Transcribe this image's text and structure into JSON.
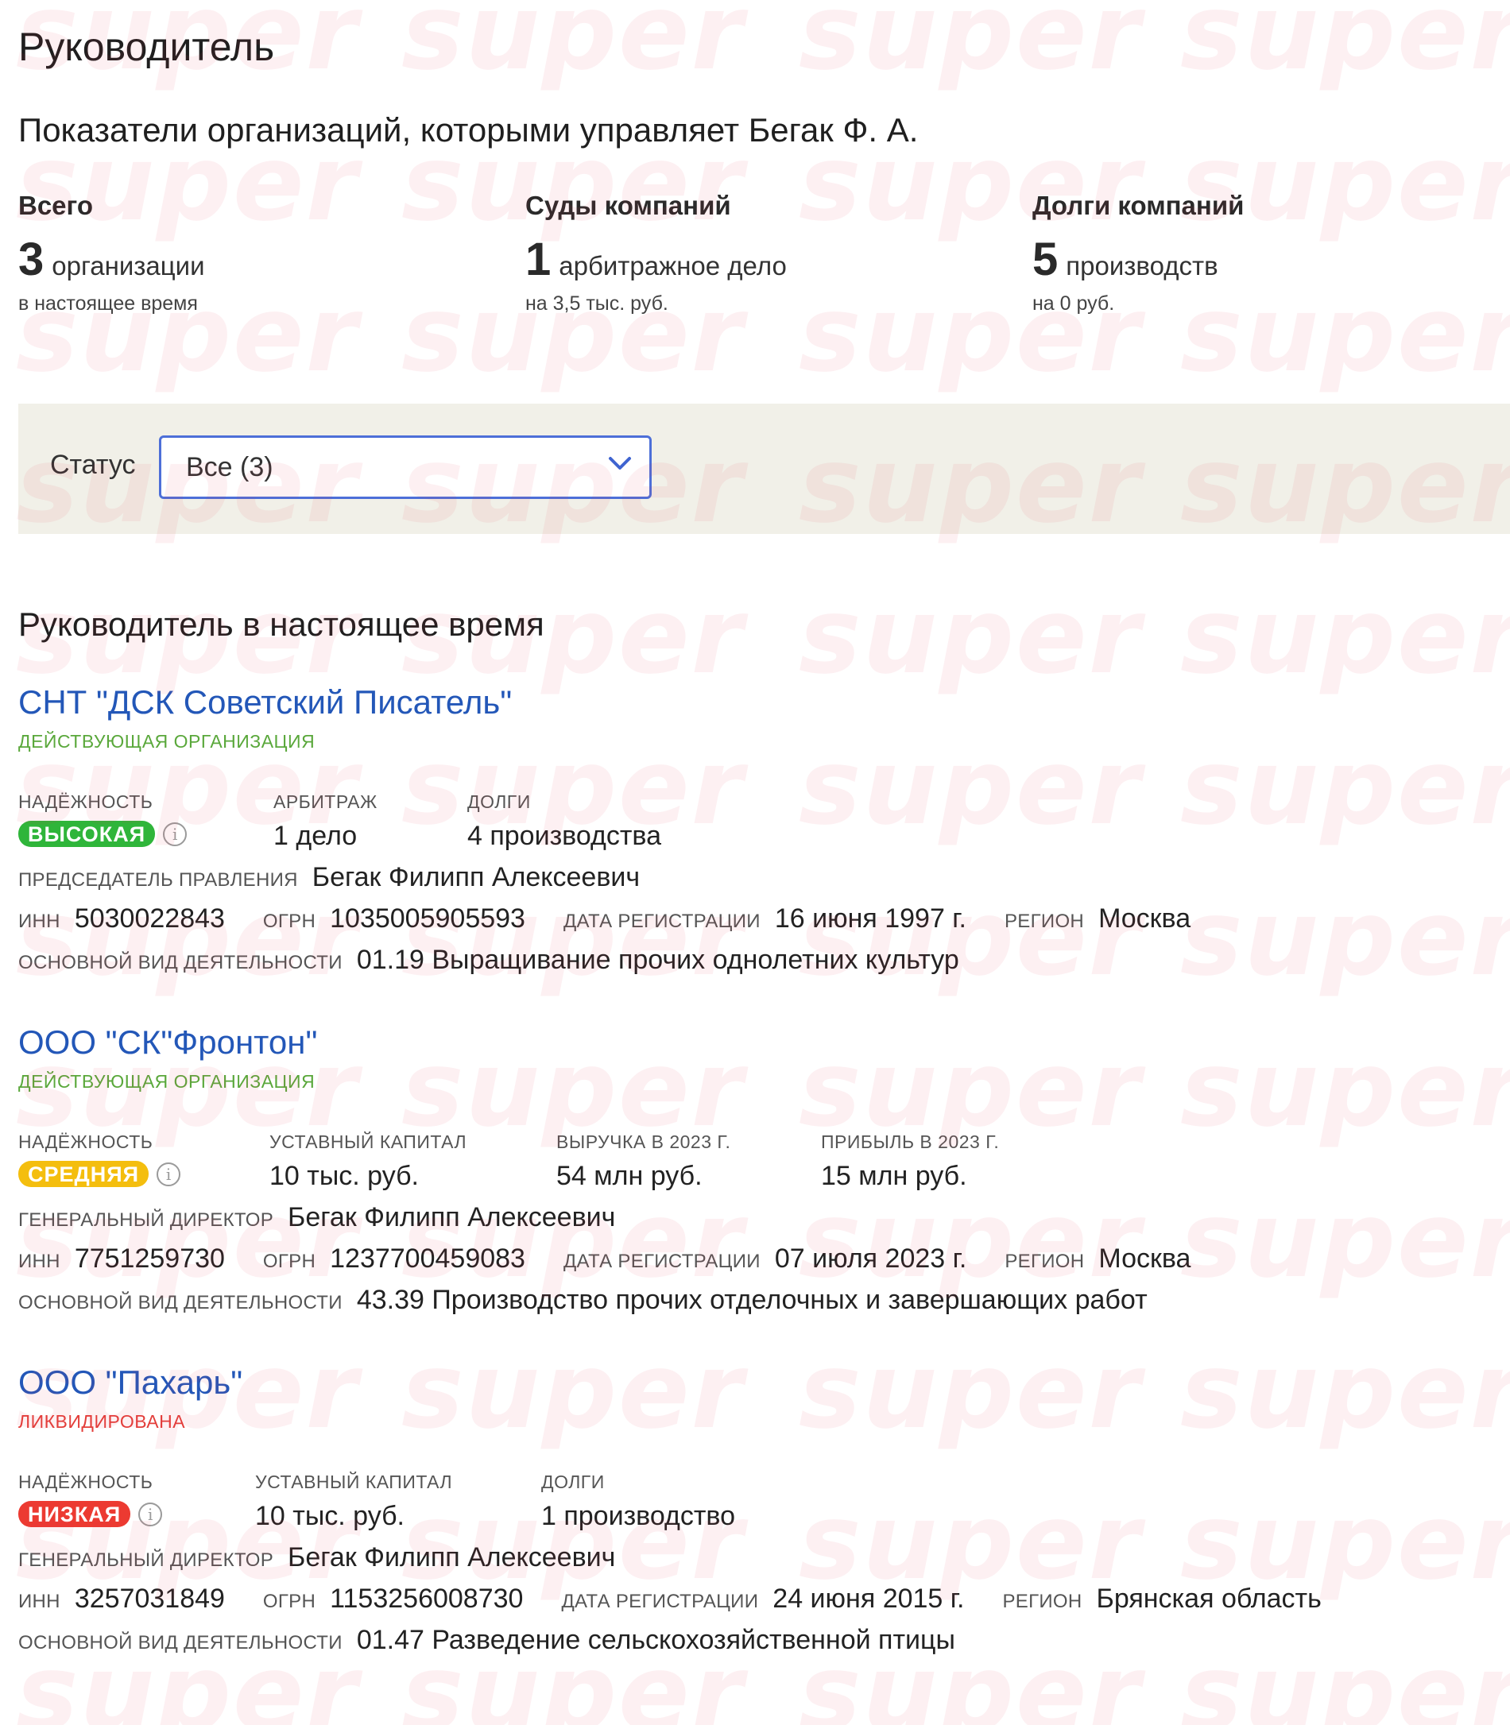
{
  "page": {
    "title": "Руководитель",
    "subtitle": "Показатели организаций, которыми управляет Бегак Ф. А.",
    "watermark_text": "super"
  },
  "stats": [
    {
      "title": "Всего",
      "number": "3",
      "unit": "организации",
      "sub": "в настоящее время"
    },
    {
      "title": "Суды компаний",
      "number": "1",
      "unit": "арбитражное дело",
      "sub": "на 3,5 тыс. руб."
    },
    {
      "title": "Долги компаний",
      "number": "5",
      "unit": "производств",
      "sub": "на 0 руб."
    }
  ],
  "filter": {
    "label": "Статус",
    "value": "Все (3)"
  },
  "section_title": "Руководитель в настоящее время",
  "companies": [
    {
      "name": "СНТ \"ДСК Советский Писатель\"",
      "status": "ДЕЙСТВУЮЩАЯ ОРГАНИЗАЦИЯ",
      "reliability_label": "НАДЁЖНОСТЬ",
      "reliability": "ВЫСОКАЯ",
      "metric2_label": "АРБИТРАЖ",
      "metric2_value": "1 дело",
      "metric3_label": "ДОЛГИ",
      "metric3_value": "4 производства",
      "head_label": "ПРЕДСЕДАТЕЛЬ ПРАВЛЕНИЯ",
      "head_name": "Бегак Филипп Алексеевич",
      "inn_label": "ИНН",
      "inn": "5030022843",
      "ogrn_label": "ОГРН",
      "ogrn": "1035005905593",
      "date_label": "ДАТА РЕГИСТРАЦИИ",
      "date": "16 июня 1997 г.",
      "region_label": "РЕГИОН",
      "region": "Москва",
      "activity_label": "ОСНОВНОЙ ВИД ДЕЯТЕЛЬНОСТИ",
      "activity": "01.19 Выращивание прочих однолетних культур"
    },
    {
      "name": "ООО \"СК\"Фронтон\"",
      "status": "ДЕЙСТВУЮЩАЯ ОРГАНИЗАЦИЯ",
      "reliability_label": "НАДЁЖНОСТЬ",
      "reliability": "СРЕДНЯЯ",
      "metric2_label": "УСТАВНЫЙ КАПИТАЛ",
      "metric2_value": "10 тыс. руб.",
      "metric3_label": "ВЫРУЧКА В 2023 Г.",
      "metric3_value": "54 млн руб.",
      "metric4_label": "ПРИБЫЛЬ В 2023 Г.",
      "metric4_value": "15 млн руб.",
      "head_label": "ГЕНЕРАЛЬНЫЙ ДИРЕКТОР",
      "head_name": "Бегак Филипп Алексеевич",
      "inn_label": "ИНН",
      "inn": "7751259730",
      "ogrn_label": "ОГРН",
      "ogrn": "1237700459083",
      "date_label": "ДАТА РЕГИСТРАЦИИ",
      "date": "07 июля 2023 г.",
      "region_label": "РЕГИОН",
      "region": "Москва",
      "activity_label": "ОСНОВНОЙ ВИД ДЕЯТЕЛЬНОСТИ",
      "activity": "43.39 Производство прочих отделочных и завершающих работ"
    },
    {
      "name": "ООО \"Пахарь\"",
      "status": "ЛИКВИДИРОВАНА",
      "reliability_label": "НАДЁЖНОСТЬ",
      "reliability": "НИЗКАЯ",
      "metric2_label": "УСТАВНЫЙ КАПИТАЛ",
      "metric2_value": "10 тыс. руб.",
      "metric3_label": "ДОЛГИ",
      "metric3_value": "1 производство",
      "head_label": "ГЕНЕРАЛЬНЫЙ ДИРЕКТОР",
      "head_name": "Бегак Филипп Алексеевич",
      "inn_label": "ИНН",
      "inn": "3257031849",
      "ogrn_label": "ОГРН",
      "ogrn": "1153256008730",
      "date_label": "ДАТА РЕГИСТРАЦИИ",
      "date": "24 июня 2015 г.",
      "region_label": "РЕГИОН",
      "region": "Брянская область",
      "activity_label": "ОСНОВНОЙ ВИД ДЕЯТЕЛЬНОСТИ",
      "activity": "01.47 Разведение сельскохозяйственной птицы"
    }
  ],
  "colors": {
    "link": "#2357b8",
    "status_active": "#5aa83b",
    "status_liquidated": "#e33e3a",
    "badge_high": "#2fb53a",
    "badge_medium": "#f4be0e",
    "badge_low": "#ec3a31",
    "filter_bg": "#f1f0e8",
    "select_border": "#4d6fd8"
  },
  "icons": {
    "dropdown": "chevron-down-icon",
    "info": "info-icon"
  }
}
